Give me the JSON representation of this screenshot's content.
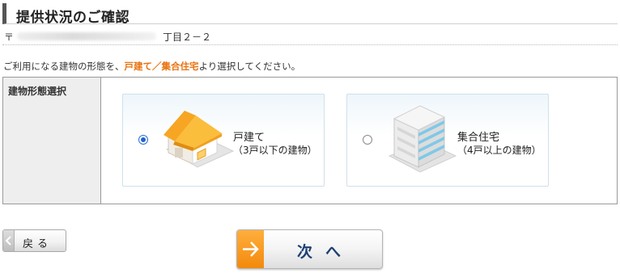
{
  "header": {
    "title": "提供状況のご確認"
  },
  "address": {
    "postal_mark": "〒",
    "suffix": "丁目２－２"
  },
  "instruction": {
    "before": "ご利用になる建物の形態を、",
    "highlight": "戸建て／集合住宅",
    "after": "より選択してください。"
  },
  "form": {
    "label": "建物形態選択",
    "options": [
      {
        "name": "戸建て",
        "description": "（3戸以下の建物）",
        "selected": true,
        "icon": "house-icon"
      },
      {
        "name": "集合住宅",
        "description": "（4戸以上の建物）",
        "selected": false,
        "icon": "apartment-building-icon"
      }
    ]
  },
  "buttons": {
    "back": "戻る",
    "next": "次へ"
  },
  "colors": {
    "highlight": "#e8720e",
    "next_accent": "#f28a0e",
    "next_text": "#1e3f74",
    "radio_selected": "#1f63d0"
  }
}
